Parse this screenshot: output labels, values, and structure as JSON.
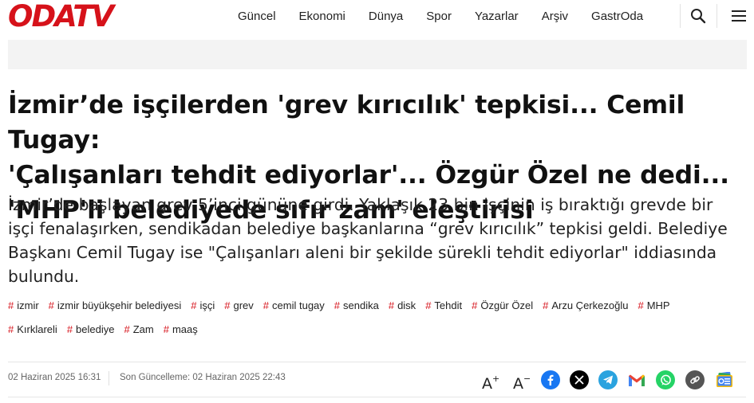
{
  "header": {
    "logo_text": "ODATV",
    "nav": [
      "Güncel",
      "Ekonomi",
      "Dünya",
      "Spor",
      "Yazarlar",
      "Arşiv",
      "GastrOda"
    ],
    "search_icon": "search-icon",
    "menu_icon": "hamburger-menu-icon"
  },
  "article": {
    "headline_lines": [
      "İzmir’de işçilerden 'grev kırıcılık' tepkisi... Cemil Tugay:",
      "'Çalışanları tehdit ediyorlar'... Özgür Özel ne dedi...",
      "'MHP'li belediyede sıfır zam' eleştirisi"
    ],
    "summary_lines": [
      "İzmir’de başlayan grev 5’inci gününe girdi. Yaklaşık 23 bin işçinin iş bıraktığı grevde bir",
      "işçi fenalaşırken, sendikadan belediye başkanlarına “grev kırıcılık” tepkisi geldi. Belediye",
      "Başkanı Cemil Tugay ise \"Çalışanları aleni bir şekilde sürekli tehdit ediyorlar\" iddiasında",
      "bulundu."
    ],
    "tags_row1": [
      "izmir",
      "izmir büyükşehir belediyesi",
      "işçi",
      "grev",
      "cemil tugay",
      "sendika",
      "disk",
      "Tehdit",
      "Özgür Özel",
      "Arzu Çerkezoğlu",
      "MHP"
    ],
    "tags_row2": [
      "Kırklareli",
      "belediye",
      "Zam",
      "maaş"
    ],
    "tag_symbol": "#",
    "published": "02 Haziran 2025 16:31",
    "updated": "Son Güncelleme: 02 Haziran 2025 22:43"
  },
  "toolbar": {
    "font_increase": "A",
    "font_increase_sup": "+",
    "font_decrease": "A",
    "font_decrease_sup": "−",
    "share_icons": [
      "facebook-icon",
      "x-twitter-icon",
      "telegram-icon",
      "gmail-icon",
      "whatsapp-icon",
      "copy-link-icon",
      "google-news-icon"
    ]
  },
  "colors": {
    "brand_red": "#d6121a",
    "facebook": "#1877f2",
    "x": "#000000",
    "telegram": "#2aa3df",
    "whatsapp": "#25d366",
    "link": "#555555",
    "tag_hash": "#d6121a"
  }
}
